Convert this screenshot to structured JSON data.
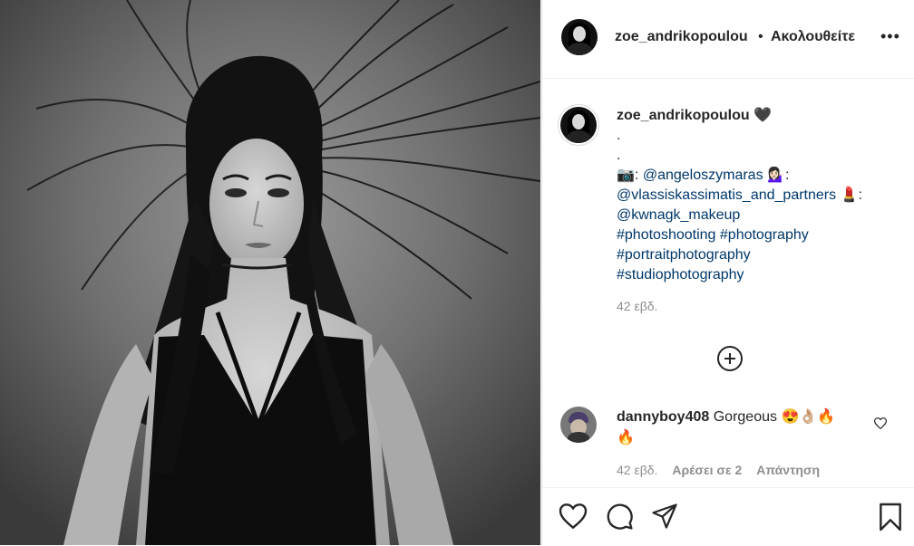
{
  "header": {
    "username": "zoe_andrikopoulou",
    "separator": "•",
    "follow_status": "Ακολουθείτε",
    "more": "•••"
  },
  "caption": {
    "username": "zoe_andrikopoulou",
    "heart": "🖤",
    "dot1": ".",
    "dot2": ".",
    "camera": "📷",
    "colon1": ":",
    "mention1": "@angeloszymaras",
    "emoji_woman": "💁🏻‍♀️",
    "colon2": ":",
    "mention2": "@vlassiskassimatis_and_partners",
    "emoji_lipstick": "💄",
    "colon3": ":",
    "mention3": "@kwnagk_makeup",
    "hashtag1": "#photoshooting",
    "hashtag2": "#photography",
    "hashtag3": "#portraitphotography",
    "hashtag4": "#studiophotography",
    "time": "42 εβδ."
  },
  "comment": {
    "username": "dannyboy408",
    "text": "Gorgeous",
    "emojis_line1": "😍👌🏼🔥",
    "emojis_line2": "🔥",
    "time": "42 εβδ.",
    "likes": "Αρέσει σε 2",
    "reply": "Απάντηση"
  },
  "icons": [
    "more-icon",
    "add-comment-icon",
    "heart-icon",
    "comment-icon",
    "share-icon",
    "bookmark-icon"
  ]
}
